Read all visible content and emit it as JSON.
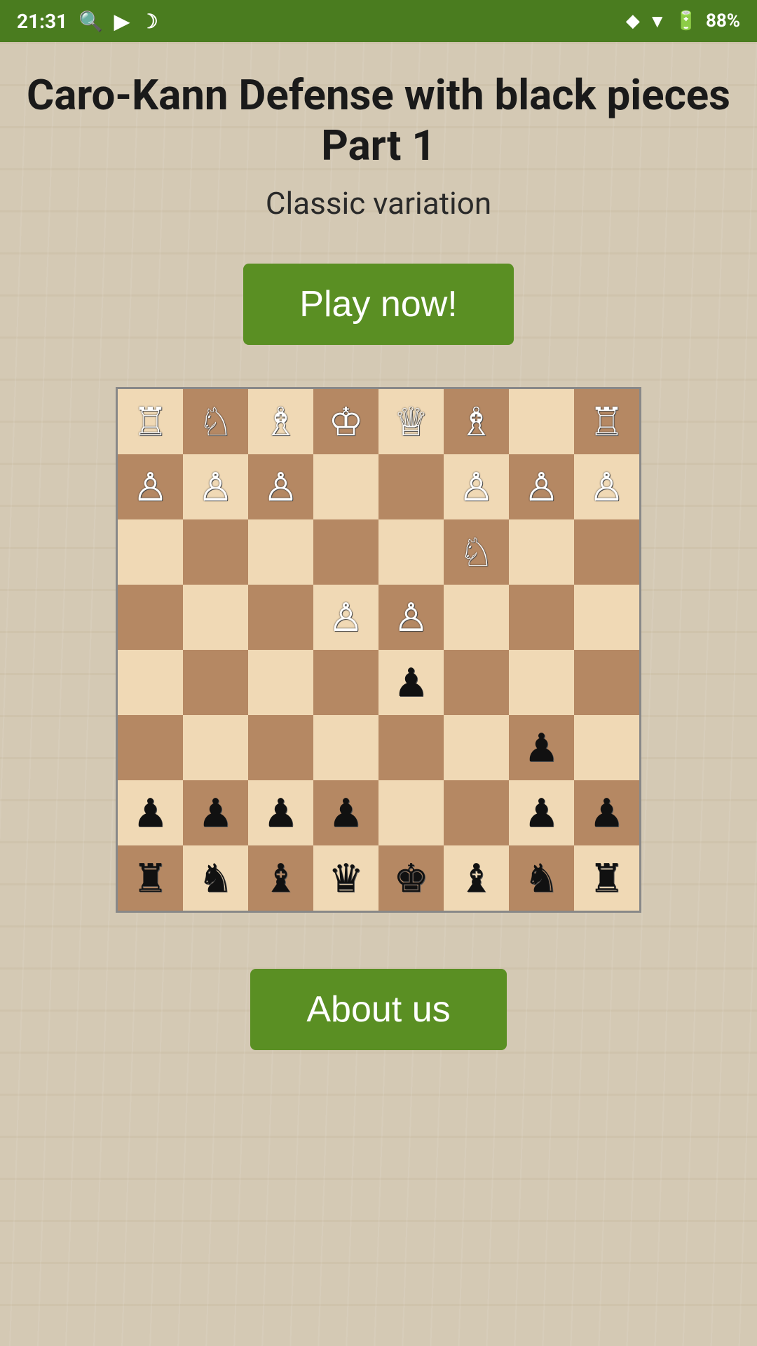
{
  "statusBar": {
    "time": "21:31",
    "battery": "88%"
  },
  "title": "Caro-Kann Defense with black pieces Part 1",
  "subtitle": "Classic variation",
  "playButton": "Play now!",
  "aboutButton": "About us",
  "board": {
    "rows": [
      [
        "♖",
        "♘",
        "♗",
        "♔",
        "♕",
        "♗",
        "·",
        "♖"
      ],
      [
        "♙",
        "♙",
        "♙",
        "·",
        "·",
        "♙",
        "♙",
        "♙"
      ],
      [
        "·",
        "·",
        "·",
        "·",
        "·",
        "♘",
        "·",
        "·"
      ],
      [
        "·",
        "·",
        "·",
        "♙",
        "♙",
        "·",
        "·",
        "·"
      ],
      [
        "·",
        "·",
        "·",
        "·",
        "♟",
        "·",
        "·",
        "·"
      ],
      [
        "·",
        "·",
        "·",
        "·",
        "·",
        "·",
        "♟",
        "·"
      ],
      [
        "♟",
        "♟",
        "♟",
        "♟",
        "·",
        "·",
        "♟",
        "♟"
      ],
      [
        "♜",
        "♞",
        "♝",
        "♛",
        "♚",
        "♝",
        "♞",
        "♜"
      ]
    ]
  }
}
